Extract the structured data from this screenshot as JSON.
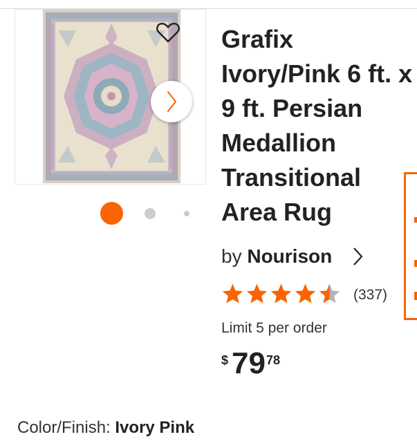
{
  "product": {
    "title": "Grafix Ivory/Pink 6 ft. x 9 ft. Persian Medallion Transitional Area Rug",
    "brand_prefix": "by",
    "brand": "Nourison",
    "rating": 4.5,
    "rating_max": 5,
    "review_count": "(337)",
    "limit_text": "Limit 5 per order",
    "price": {
      "currency": "$",
      "dollars": "79",
      "cents": "78"
    },
    "color_label": "Color/Finish:",
    "color_value": "Ivory Pink"
  },
  "gallery": {
    "image_count": 3,
    "active_index": 0
  },
  "colors": {
    "accent": "#f96302",
    "star": "#f96302",
    "star_empty": "#b3b3b3",
    "dot_inactive": "#cccccc",
    "text": "#222222"
  },
  "icons": {
    "favorite": "heart-icon",
    "next": "chevron-right-icon",
    "brand": "chevron-right-icon",
    "rating": "star-icon"
  }
}
